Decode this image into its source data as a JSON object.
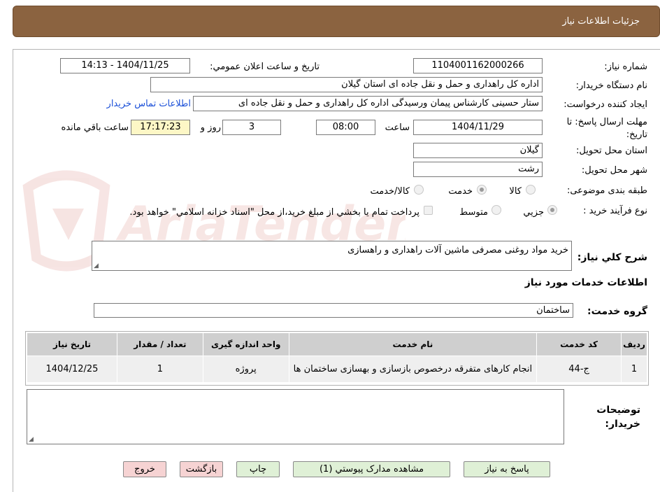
{
  "header": {
    "title": "جزئیات اطلاعات نیاز"
  },
  "watermark": {
    "text": "AriaTender.neT"
  },
  "fields": {
    "need_number_label": "شماره نیاز:",
    "need_number_value": "1104001162000266",
    "announce_label": "تاریخ و ساعت اعلان عمومي:",
    "announce_value": "1404/11/25 - 14:13",
    "buyer_org_label": "نام دستگاه خريدار:",
    "buyer_org_value": "اداره کل راهداری و حمل و نقل جاده ای استان گیلان",
    "requester_label": "ايجاد کننده درخواست:",
    "requester_value": "ستار حسینی کارشناس پیمان ورسیدگی اداره کل راهداری و حمل و نقل جاده ای",
    "contact_link": "اطلاعات تماس خريدار",
    "deadline_label": "مهلت ارسال پاسخ: تا تاريخ:",
    "deadline_date": "1404/11/29",
    "time_label": "ساعت",
    "deadline_time": "08:00",
    "days_value": "3",
    "days_label": "روز و",
    "remaining_time": "17:17:23",
    "remaining_label": "ساعت باقي مانده",
    "province_label": "استان محل تحويل:",
    "province_value": "گیلان",
    "city_label": "شهر محل تحويل:",
    "city_value": "رشت",
    "category_label": "طبقه بندی موضوعی:",
    "category_options": [
      "کالا",
      "خدمت",
      "کالا/خدمت"
    ],
    "category_selected": "خدمت",
    "process_label": "نوع فرآيند خريد :",
    "process_options": [
      "جزيي",
      "متوسط"
    ],
    "process_selected": "جزيي",
    "payment_note": "پرداخت تمام يا بخشي از مبلغ خريد،از محل \"اسناد خزانه اسلامي\" خواهد بود."
  },
  "description": {
    "label": "شرح كلي نياز:",
    "value": "خرید مواد روغنی مصرفی ماشین آلات راهداری و راهسازی"
  },
  "services_section": {
    "title": "اطلاعات خدمات مورد نياز",
    "group_label": "گروه خدمت:",
    "group_value": "ساختمان"
  },
  "table": {
    "headers": [
      "رديف",
      "کد خدمت",
      "نام خدمت",
      "واحد اندازه گيری",
      "تعداد / مقدار",
      "تاريخ نياز"
    ],
    "rows": [
      [
        "1",
        "ج-44",
        "انجام کارهای متفرقه درخصوص بازسازی و بهسازی ساختمان ها",
        "پروژه",
        "1",
        "1404/12/25"
      ]
    ]
  },
  "buyer_notes": {
    "label": "توضيحات خريدار:",
    "value": ""
  },
  "buttons": {
    "reply": "پاسخ به نياز",
    "attachments": "مشاهده مدارک پيوستي (1)",
    "print": "چاپ",
    "back": "بازگشت",
    "exit": "خروج"
  },
  "colors": {
    "header_bg": "#8b6340",
    "link": "#1a4fd8",
    "button_green": "#dff0d6",
    "button_pink": "#f6d3d3",
    "remaining_bg": "#fdf7c6"
  }
}
